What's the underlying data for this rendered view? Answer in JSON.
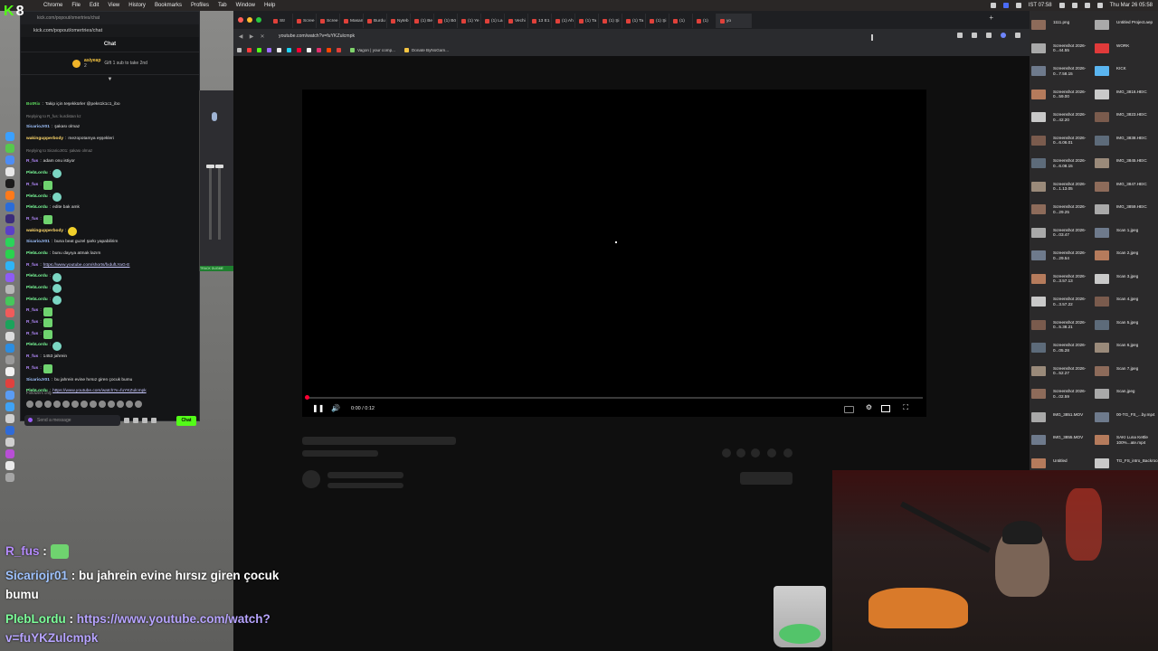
{
  "menubar": {
    "app": "Chrome",
    "items": [
      "File",
      "Edit",
      "View",
      "History",
      "Bookmarks",
      "Profiles",
      "Tab",
      "Window",
      "Help"
    ],
    "ist_time": "IST 07:58",
    "date_time": "Thu Mar 26  05:58"
  },
  "kick_logo": {
    "letter": "K",
    "number": "8"
  },
  "kick": {
    "url_small": "kick.com/popout/omertries/chat",
    "url": "kick.com/popout/omertries/chat",
    "chat_title": "Chat",
    "gift": {
      "user": "asiyeap",
      "count": "2",
      "text": "Gift 1 sub to take 2nd"
    },
    "messages": [
      {
        "user": "BotRix",
        "color": "#5cd65c",
        "text": "Takip için teşekkürler @peks1k1c1_ibo"
      },
      {
        "reply": "Replying to R_fus: kurdistan kz"
      },
      {
        "user": "SicarioJr01",
        "color": "#9fc3ff",
        "text": "şakası olmaz"
      },
      {
        "user": "wakingupperbody",
        "color": "#ffd86b",
        "text": "mezopotamya eşşekleri"
      },
      {
        "reply": "Replying to SicarioJr01: şakası olmaz"
      },
      {
        "user": "R_fus",
        "color": "#b68cff",
        "text": "adam onu istiyor"
      },
      {
        "user": "PlebLordu",
        "color": "#7cff9a",
        "text": "",
        "emote": "round"
      },
      {
        "user": "R_fus",
        "color": "#b68cff",
        "text": "",
        "emote": "square"
      },
      {
        "user": "PlebLordu",
        "color": "#7cff9a",
        "text": "",
        "emote": "round"
      },
      {
        "user": "PlebLordu",
        "color": "#7cff9a",
        "text": "edite bak amk"
      },
      {
        "user": "R_fus",
        "color": "#b68cff",
        "text": "",
        "emote": "square"
      },
      {
        "user": "wakingupperbody",
        "color": "#ffd86b",
        "text": "",
        "emote": "yellow"
      },
      {
        "user": "SicarioJr01",
        "color": "#9fc3ff",
        "text": "buna beat guzel şarkı yapabilirim"
      },
      {
        "user": "PlebLordu",
        "color": "#7cff9a",
        "text": "bunu dayıya atmak lazım"
      },
      {
        "user": "R_fus",
        "color": "#b68cff",
        "link": "https://www.youtube.com/shorts/fxdufLYaG-E"
      },
      {
        "user": "PlebLordu",
        "color": "#7cff9a",
        "text": "",
        "emote": "round"
      },
      {
        "user": "PlebLordu",
        "color": "#7cff9a",
        "text": "",
        "emote": "round"
      },
      {
        "user": "PlebLordu",
        "color": "#7cff9a",
        "text": "",
        "emote": "round"
      },
      {
        "user": "R_fus",
        "color": "#b68cff",
        "text": "",
        "emote": "square"
      },
      {
        "user": "R_fus",
        "color": "#b68cff",
        "text": "",
        "emote": "square"
      },
      {
        "user": "R_fus",
        "color": "#b68cff",
        "text": "",
        "emote": "square"
      },
      {
        "user": "PlebLordu",
        "color": "#7cff9a",
        "text": "",
        "emote": "round"
      },
      {
        "user": "R_fus",
        "color": "#b68cff",
        "text": "1453 jahrein"
      },
      {
        "user": "R_fus",
        "color": "#b68cff",
        "text": "",
        "emote": "square"
      },
      {
        "user": "SicarioJr01",
        "color": "#9fc3ff",
        "text": "bu jahrein evine hırsız giren çocuk bumu"
      },
      {
        "user": "PlebLordu",
        "color": "#7cff9a",
        "link": "https://www.youtube.com/watch?v=fuYKZulcmpk"
      }
    ],
    "followers_only": "Followers only",
    "input_placeholder": "Send a message",
    "send_label": "Chat"
  },
  "obs": {
    "strip_text": "TRACK DUGME"
  },
  "browser": {
    "tabs": [
      "Str",
      "Scree",
      "Scree",
      "Masan",
      "Burdu",
      "Nyteb",
      "(1) Be",
      "(1) Bö",
      "(1) Ye",
      "(1) La",
      "Vechi",
      "13 E1",
      "(1) Ah",
      "(1) Ta",
      "(1) Şi",
      "(1) Ta",
      "(1) Şi",
      "(1)",
      "(1)",
      "yo"
    ],
    "url": "youtube.com/watch?v=fuYKZulcmpk",
    "bookmarks": [
      "Vagon | your comp...",
      "Donate ByNoGam..."
    ]
  },
  "video": {
    "time": "0:00 / 0:12",
    "progress": 0
  },
  "desktop_files": {
    "left_column": [
      {
        "name": "1111.png"
      },
      {
        "name": "Screenshot 2026-0...44.55"
      },
      {
        "name": "Screenshot 2026-0...7.58.15"
      },
      {
        "name": "Screenshot 2026-0...59.00"
      },
      {
        "name": "Screenshot 2026-0...42.20"
      },
      {
        "name": "Screenshot 2026-0...6.06.01"
      },
      {
        "name": "Screenshot 2026-0...6.08.15"
      },
      {
        "name": "Screenshot 2026-0...1.13.05"
      },
      {
        "name": "Screenshot 2026-0...29.25"
      },
      {
        "name": "Screenshot 2026-0...03.47"
      },
      {
        "name": "Screenshot 2026-0...29.54"
      },
      {
        "name": "Screenshot 2026-0...3.57.13"
      },
      {
        "name": "Screenshot 2026-0...3.57.22"
      },
      {
        "name": "Screenshot 2026-0...5.38.21"
      },
      {
        "name": "Screenshot 2026-0...05.28"
      },
      {
        "name": "Screenshot 2026-0...52.27"
      },
      {
        "name": "Screenshot 2026-0...02.59"
      },
      {
        "name": "IMG_3851.MOV"
      },
      {
        "name": "IMG_3855.MOV"
      },
      {
        "name": "Untitled"
      }
    ],
    "right_column": [
      {
        "name": "Untitled Project.aep"
      },
      {
        "name": "WORK"
      },
      {
        "name": "KICK"
      },
      {
        "name": "IMG_3816.HEIC"
      },
      {
        "name": "IMG_3823.HEIC"
      },
      {
        "name": "IMG_3838.HEIC"
      },
      {
        "name": "IMG_3845.HEIC"
      },
      {
        "name": "IMG_3847.HEIC"
      },
      {
        "name": "IMG_3859.HEIC"
      },
      {
        "name": "Scan 1.jpeg"
      },
      {
        "name": "Scan 2.jpeg"
      },
      {
        "name": "Scan 3.jpeg"
      },
      {
        "name": "Scan 4.jpeg"
      },
      {
        "name": "Scan 5.jpeg"
      },
      {
        "name": "Scan 6.jpeg"
      },
      {
        "name": "Scan 7.jpeg"
      },
      {
        "name": "Scan.jpeg"
      },
      {
        "name": "00-TG_FS_...by.mp4"
      },
      {
        "name": "SAKI Luna Kettle 100%...ate.mp4"
      },
      {
        "name": "TG_FS_intro_Backroom...le.mp4"
      }
    ]
  },
  "overlay_chat": {
    "line1_user": "R_fus",
    "line1_sep": " : ",
    "line2_user": "Sicariojr01",
    "line2_text": " : bu jahrein evine hırsız giren çocuk",
    "line3_text": "bumu",
    "line4_user": "PlebLordu",
    "line4_sep": " : ",
    "line4_link": "https://www.youtube.com/watch?",
    "line5_link": "v=fuYKZulcmpk"
  },
  "colors": {
    "kick_green": "#53fc18",
    "youtube_red": "#ff0033",
    "browser_bg": "#0f0f0f"
  }
}
